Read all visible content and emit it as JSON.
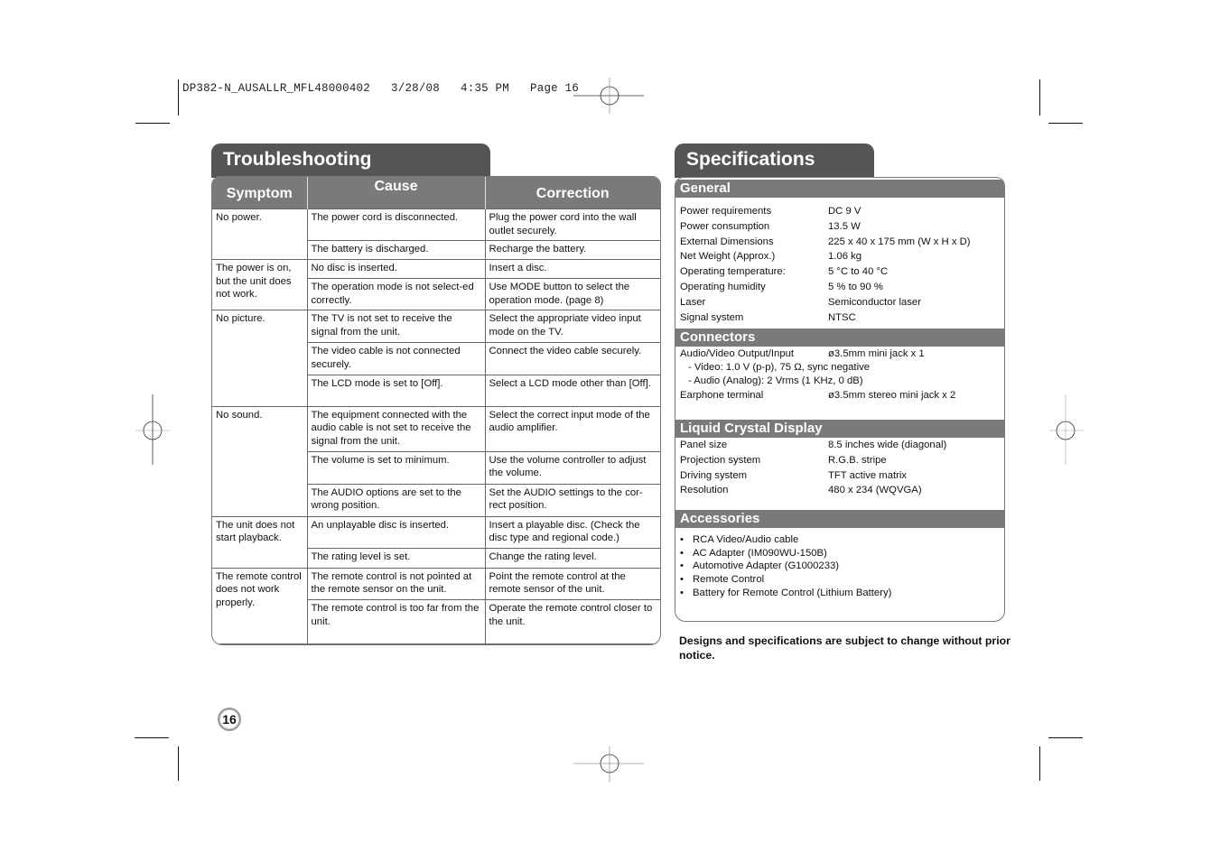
{
  "slug": "DP382-N_AUSALLR_MFL48000402   3/28/08   4:35 PM   Page 16",
  "page_number": "16",
  "troubleshooting": {
    "title": "Troubleshooting",
    "headers": [
      "Symptom",
      "Cause",
      "Correction"
    ],
    "groups": [
      {
        "symptom": "No power.",
        "rows": [
          {
            "cause": "The power cord is disconnected.",
            "correction": "Plug the power cord into the wall outlet securely."
          },
          {
            "cause": "The battery is discharged.",
            "correction": "Recharge the battery."
          }
        ]
      },
      {
        "symptom": "The power is on, but the unit does not work.",
        "rows": [
          {
            "cause": "No disc is inserted.",
            "correction": "Insert a disc."
          },
          {
            "cause": "The operation mode is not select-ed correctly.",
            "correction": "Use MODE button to select the operation mode. (page 8)"
          }
        ]
      },
      {
        "symptom": "No picture.",
        "rows": [
          {
            "cause": "The TV is not set to receive the signal from the unit.",
            "correction": "Select the appropriate video input mode on the TV."
          },
          {
            "cause": "The video cable is not connected securely.",
            "correction": "Connect the video cable securely."
          },
          {
            "cause": "The LCD mode is set to [Off].",
            "correction": "Select a LCD mode other than [Off]."
          }
        ]
      },
      {
        "symptom": "No sound.",
        "rows": [
          {
            "cause": "The equipment connected with the audio cable is not set to receive the signal from the unit.",
            "correction": "Select the correct input mode of the audio amplifier."
          },
          {
            "cause": "The volume is set to minimum.",
            "correction": "Use the volume controller to adjust the volume."
          },
          {
            "cause": "The AUDIO options are set to the wrong position.",
            "correction": "Set the AUDIO settings to the cor-rect position."
          }
        ]
      },
      {
        "symptom": "The unit does not start playback.",
        "rows": [
          {
            "cause": "An unplayable disc is inserted.",
            "correction": "Insert a playable disc. (Check the disc type and regional code.)"
          },
          {
            "cause": "The rating level is set.",
            "correction": "Change the rating level."
          }
        ]
      },
      {
        "symptom": "The remote control does not work properly.",
        "rows": [
          {
            "cause": "The remote control is not pointed at the remote sensor on the unit.",
            "correction": "Point the remote control at the remote sensor of the unit."
          },
          {
            "cause": "The remote control is too far from the unit.",
            "correction": "Operate the remote control closer to the unit."
          }
        ]
      }
    ]
  },
  "specifications": {
    "title": "Specifications",
    "general": {
      "heading": "General",
      "items": [
        {
          "k": "Power requirements",
          "v": "DC 9 V"
        },
        {
          "k": "Power consumption",
          "v": "13.5 W"
        },
        {
          "k": "External Dimensions",
          "v": "225 x 40 x 175 mm (W x H x D)"
        },
        {
          "k": "Net Weight (Approx.)",
          "v": "1.06 kg"
        },
        {
          "k": "Operating temperature:",
          "v": "5 °C to 40 °C"
        },
        {
          "k": "Operating humidity",
          "v": "5 % to 90 %"
        },
        {
          "k": "Laser",
          "v": "Semiconductor laser"
        },
        {
          "k": "Signal system",
          "v": "NTSC"
        }
      ]
    },
    "connectors": {
      "heading": "Connectors",
      "av_key": "Audio/Video Output/Input",
      "av_value": "ø3.5mm mini jack x 1",
      "video_sub": "- Video: 1.0 V (p-p), 75 Ω, sync negative",
      "audio_sub": "- Audio (Analog): 2 Vrms (1 KHz, 0 dB)",
      "ear_key": "Earphone terminal",
      "ear_value": "ø3.5mm stereo mini jack x 2"
    },
    "lcd": {
      "heading": "Liquid Crystal Display",
      "items": [
        {
          "k": "Panel size",
          "v": "8.5 inches wide (diagonal)"
        },
        {
          "k": "Projection system",
          "v": "R.G.B. stripe"
        },
        {
          "k": "Driving system",
          "v": "TFT active matrix"
        },
        {
          "k": "Resolution",
          "v": "480 x 234 (WQVGA)"
        }
      ]
    },
    "accessories": {
      "heading": "Accessories",
      "items": [
        "RCA Video/Audio cable",
        "AC Adapter (IM090WU-150B)",
        "Automotive Adapter (G1000233)",
        "Remote Control",
        "Battery for Remote Control (Lithium Battery)"
      ]
    },
    "notice": "Designs and specifications are subject to change without prior notice."
  }
}
